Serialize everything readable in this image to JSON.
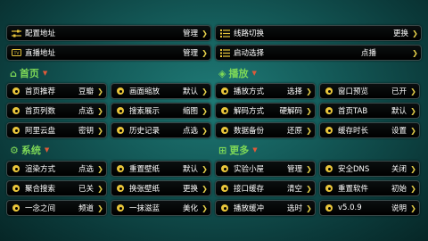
{
  "top": [
    {
      "icon": "sliders-icon",
      "label": "配置地址",
      "value": "管理"
    },
    {
      "icon": "list-icon",
      "label": "线路切换",
      "value": "更换"
    },
    {
      "icon": "tv-icon",
      "label": "直播地址",
      "value": "管理"
    },
    {
      "icon": "list-icon",
      "label": "启动选择",
      "value": "点播"
    }
  ],
  "sections": {
    "home": {
      "title": "首页",
      "color": "#7ed957",
      "icon": "home-icon"
    },
    "play": {
      "title": "播放",
      "color": "#7ed957",
      "icon": "play-icon"
    },
    "system": {
      "title": "系统",
      "color": "#7ed957",
      "icon": "gear-icon"
    },
    "more": {
      "title": "更多",
      "color": "#7ed957",
      "icon": "grid-icon"
    }
  },
  "rows": [
    [
      "首页推荐",
      "豆瓣",
      "画面缩放",
      "默认",
      "播放方式",
      "选择",
      "窗口预览",
      "已开"
    ],
    [
      "首页列数",
      "点选",
      "搜索展示",
      "缩图",
      "解码方式",
      "硬解码",
      "首页TAB",
      "默认"
    ],
    [
      "阿里云盘",
      "密钥",
      "历史记录",
      "点选",
      "数据备份",
      "还原",
      "缓存时长",
      "设置"
    ],
    [
      "渲染方式",
      "点选",
      "重置壁纸",
      "默认",
      "实验小屋",
      "管理",
      "安全DNS",
      "关闭"
    ],
    [
      "聚合搜索",
      "已关",
      "换张壁纸",
      "更换",
      "接口缓存",
      "清空",
      "重置软件",
      "初始"
    ],
    [
      "一念之间",
      "频道",
      "一抹滋蓝",
      "美化",
      "播放缓冲",
      "选时",
      "v5.0.9",
      "说明"
    ]
  ],
  "colors": {
    "accent": "#e9c63b",
    "section": "#7ed957"
  }
}
